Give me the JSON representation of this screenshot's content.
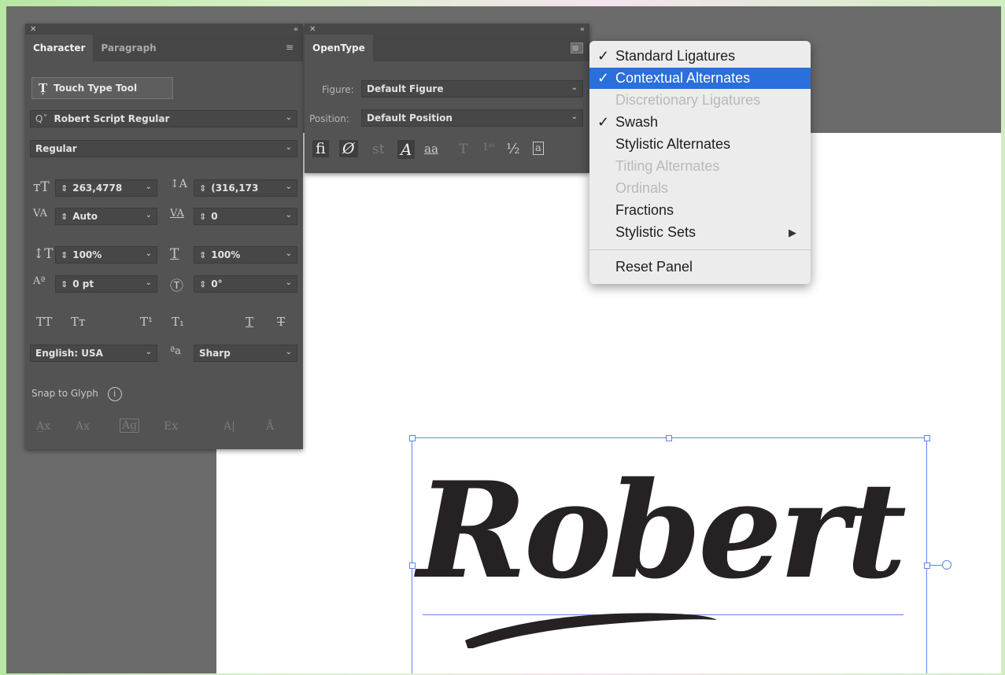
{
  "character_panel": {
    "tabs": [
      "Character",
      "Paragraph"
    ],
    "touch_type_label": "Touch Type Tool",
    "font_family": "Robert Script Regular",
    "font_style": "Regular",
    "font_size": "263,4778",
    "leading": "(316,173",
    "kerning": "Auto",
    "tracking": "0",
    "vertical_scale": "100%",
    "horizontal_scale": "100%",
    "baseline_shift": "0 pt",
    "rotation": "0°",
    "language": "English: USA",
    "antialias": "Sharp",
    "snap_label": "Snap to Glyph"
  },
  "opentype_panel": {
    "tab": "OpenType",
    "figure_label": "Figure:",
    "figure_value": "Default Figure",
    "position_label": "Position:",
    "position_value": "Default Position"
  },
  "context_menu": {
    "items": [
      {
        "label": "Standard Ligatures",
        "checked": true,
        "state": "normal"
      },
      {
        "label": "Contextual Alternates",
        "checked": true,
        "state": "selected"
      },
      {
        "label": "Discretionary Ligatures",
        "checked": false,
        "state": "disabled"
      },
      {
        "label": "Swash",
        "checked": true,
        "state": "normal"
      },
      {
        "label": "Stylistic Alternates",
        "checked": false,
        "state": "normal"
      },
      {
        "label": "Titling Alternates",
        "checked": false,
        "state": "disabled"
      },
      {
        "label": "Ordinals",
        "checked": false,
        "state": "disabled"
      },
      {
        "label": "Fractions",
        "checked": false,
        "state": "normal"
      },
      {
        "label": "Stylistic Sets",
        "checked": false,
        "state": "normal",
        "submenu": true
      }
    ],
    "reset_label": "Reset Panel"
  },
  "canvas": {
    "text": "Robert",
    "accent_color": "#5c84e8"
  }
}
